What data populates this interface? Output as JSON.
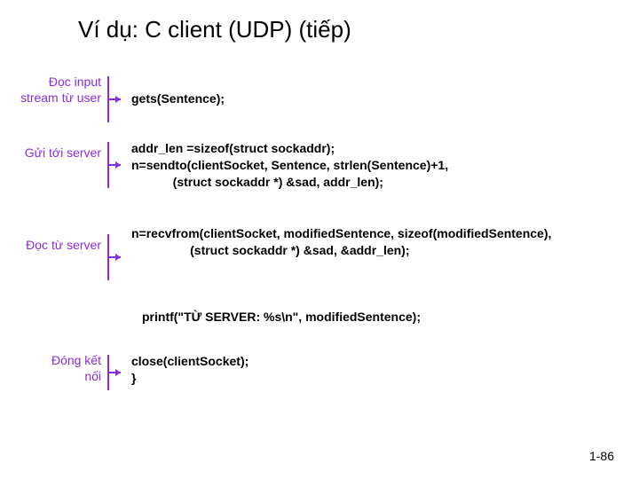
{
  "title": "Ví dụ: C client (UDP) (tiếp)",
  "blocks": {
    "read_input": {
      "label": "Đọc\ninput stream\ntừ user",
      "code": "gets(Sentence);"
    },
    "send": {
      "label": "Gửi\ntới server",
      "code": "addr_len =sizeof(struct sockaddr);\nn=sendto(clientSocket, Sentence, strlen(Sentence)+1,\n            (struct sockaddr *) &sad, addr_len);"
    },
    "recv": {
      "label": "Đọc\ntừ server",
      "code": "n=recvfrom(clientSocket, modifiedSentence, sizeof(modifiedSentence),\n                 (struct sockaddr *) &sad, &addr_len);"
    },
    "printf": {
      "code": "printf(\"TỪ SERVER: %s\\n\", modifiedSentence);"
    },
    "close": {
      "label": "Đóng\nkết nối",
      "code": "close(clientSocket);\n}"
    }
  },
  "pagenum": "1-86"
}
